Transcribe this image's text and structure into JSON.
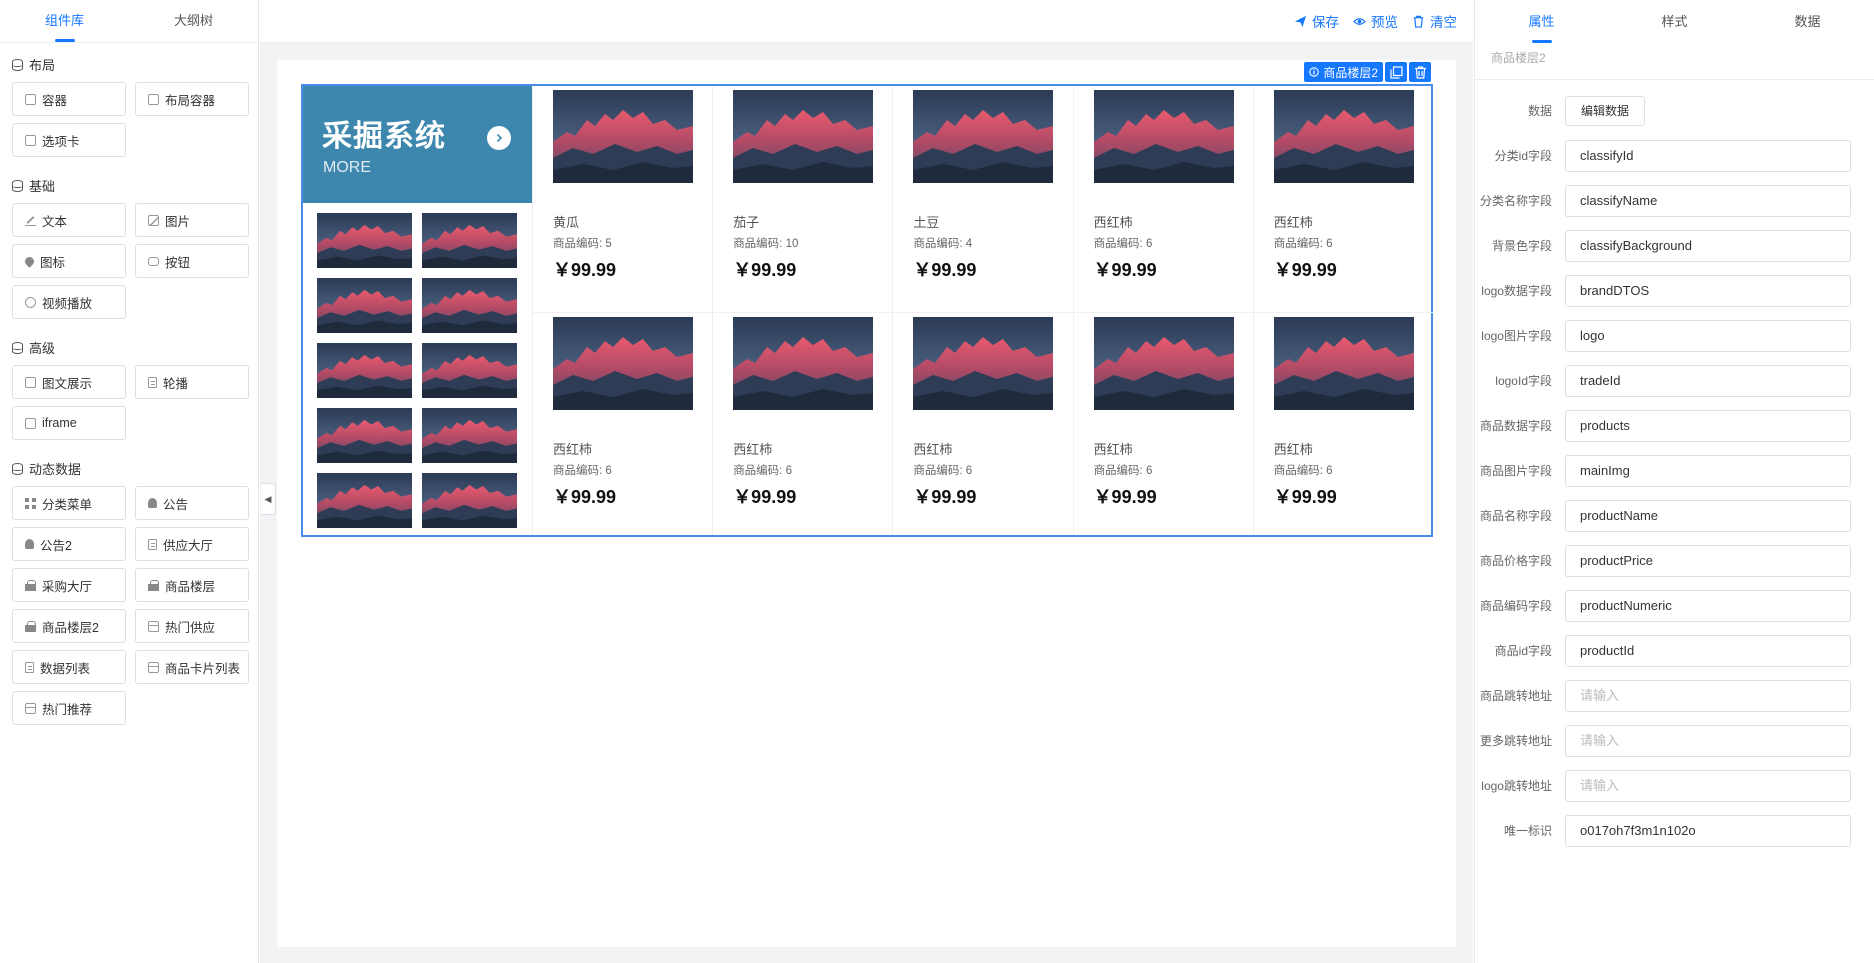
{
  "left_panel": {
    "tabs": [
      {
        "label": "组件库",
        "active": true
      },
      {
        "label": "大纲树",
        "active": false
      }
    ],
    "groups": [
      {
        "title": "布局",
        "items": [
          {
            "label": "容器",
            "icon": "container-icon"
          },
          {
            "label": "布局容器",
            "icon": "layout-container-icon"
          },
          {
            "label": "选项卡",
            "icon": "tabs-icon"
          }
        ]
      },
      {
        "title": "基础",
        "items": [
          {
            "label": "文本",
            "icon": "text-icon"
          },
          {
            "label": "图片",
            "icon": "image-icon"
          },
          {
            "label": "图标",
            "icon": "icon-icon"
          },
          {
            "label": "按钮",
            "icon": "button-icon"
          },
          {
            "label": "视频播放",
            "icon": "video-icon"
          }
        ]
      },
      {
        "title": "高级",
        "items": [
          {
            "label": "图文展示",
            "icon": "image-text-icon"
          },
          {
            "label": "轮播",
            "icon": "carousel-icon"
          },
          {
            "label": "iframe",
            "icon": "iframe-icon"
          }
        ]
      },
      {
        "title": "动态数据",
        "items": [
          {
            "label": "分类菜单",
            "icon": "category-menu-icon"
          },
          {
            "label": "公告",
            "icon": "bell-icon"
          },
          {
            "label": "公告2",
            "icon": "bell-icon"
          },
          {
            "label": "供应大厅",
            "icon": "supply-hall-icon"
          },
          {
            "label": "采购大厅",
            "icon": "purchase-hall-icon"
          },
          {
            "label": "商品楼层",
            "icon": "shop-icon"
          },
          {
            "label": "商品楼层2",
            "icon": "shop-icon"
          },
          {
            "label": "热门供应",
            "icon": "hot-supply-icon"
          },
          {
            "label": "数据列表",
            "icon": "data-list-icon"
          },
          {
            "label": "商品卡片列表",
            "icon": "card-list-icon"
          },
          {
            "label": "热门推荐",
            "icon": "hot-recommend-icon"
          }
        ]
      }
    ]
  },
  "toolbar": {
    "save": "保存",
    "preview": "预览",
    "clear": "清空"
  },
  "colors": {
    "accent": "#1677ff",
    "classify_bg": "#3d86ad",
    "selection_border": "#4a8de8"
  },
  "floor": {
    "badge_label": "商品楼层2",
    "classify_title": "采掘系统",
    "classify_more": "MORE",
    "logo_count": 10,
    "products": [
      {
        "name": "黄瓜",
        "code": "商品编码: 5",
        "price": "￥99.99"
      },
      {
        "name": "茄子",
        "code": "商品编码: 10",
        "price": "￥99.99"
      },
      {
        "name": "土豆",
        "code": "商品编码: 4",
        "price": "￥99.99"
      },
      {
        "name": "西红柿",
        "code": "商品编码: 6",
        "price": "￥99.99"
      },
      {
        "name": "西红柿",
        "code": "商品编码: 6",
        "price": "￥99.99"
      },
      {
        "name": "西红柿",
        "code": "商品编码: 6",
        "price": "￥99.99"
      },
      {
        "name": "西红柿",
        "code": "商品编码: 6",
        "price": "￥99.99"
      },
      {
        "name": "西红柿",
        "code": "商品编码: 6",
        "price": "￥99.99"
      },
      {
        "name": "西红柿",
        "code": "商品编码: 6",
        "price": "￥99.99"
      },
      {
        "name": "西红柿",
        "code": "商品编码: 6",
        "price": "￥99.99"
      }
    ]
  },
  "right_panel": {
    "tabs": [
      {
        "label": "属性",
        "active": true
      },
      {
        "label": "样式",
        "active": false
      },
      {
        "label": "数据",
        "active": false
      }
    ],
    "breadcrumb": "商品楼层2",
    "data_label": "数据",
    "edit_data_button": "编辑数据",
    "fields": [
      {
        "label": "分类id字段",
        "value": "classifyId",
        "placeholder": "请输入"
      },
      {
        "label": "分类名称字段",
        "value": "classifyName",
        "placeholder": "请输入"
      },
      {
        "label": "背景色字段",
        "value": "classifyBackground",
        "placeholder": "请输入"
      },
      {
        "label": "logo数据字段",
        "value": "brandDTOS",
        "placeholder": "请输入"
      },
      {
        "label": "logo图片字段",
        "value": "logo",
        "placeholder": "请输入"
      },
      {
        "label": "logoId字段",
        "value": "tradeId",
        "placeholder": "请输入"
      },
      {
        "label": "商品数据字段",
        "value": "products",
        "placeholder": "请输入"
      },
      {
        "label": "商品图片字段",
        "value": "mainImg",
        "placeholder": "请输入"
      },
      {
        "label": "商品名称字段",
        "value": "productName",
        "placeholder": "请输入"
      },
      {
        "label": "商品价格字段",
        "value": "productPrice",
        "placeholder": "请输入"
      },
      {
        "label": "商品编码字段",
        "value": "productNumeric",
        "placeholder": "请输入"
      },
      {
        "label": "商品id字段",
        "value": "productId",
        "placeholder": "请输入"
      },
      {
        "label": "商品跳转地址",
        "value": "",
        "placeholder": "请输入"
      },
      {
        "label": "更多跳转地址",
        "value": "",
        "placeholder": "请输入"
      },
      {
        "label": "logo跳转地址",
        "value": "",
        "placeholder": "请输入"
      },
      {
        "label": "唯一标识",
        "value": "o017oh7f3m1n102o",
        "placeholder": "请输入"
      }
    ]
  }
}
